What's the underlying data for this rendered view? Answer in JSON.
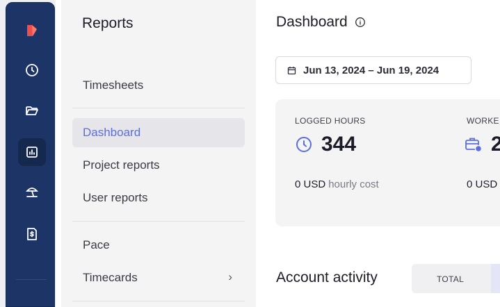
{
  "rail": {
    "items": [
      {
        "icon": "app-logo-icon"
      },
      {
        "icon": "clock-icon"
      },
      {
        "icon": "folder-icon"
      },
      {
        "icon": "reports-chart-icon",
        "active": true
      },
      {
        "icon": "beach-umbrella-icon"
      },
      {
        "icon": "invoice-dollar-icon"
      }
    ],
    "colors": {
      "bg": "#1d3466",
      "logo": "#f04e4e"
    }
  },
  "sidebar": {
    "title": "Reports",
    "items": [
      {
        "label": "Timesheets"
      },
      {
        "label": "Dashboard",
        "active": true
      },
      {
        "label": "Project reports"
      },
      {
        "label": "User reports"
      },
      {
        "label": "Pace"
      },
      {
        "label": "Timecards",
        "chevron": "›"
      }
    ]
  },
  "main": {
    "title": "Dashboard",
    "date_range": "Jun 13, 2024 – Jun 19, 2024",
    "stats": [
      {
        "label": "LOGGED HOURS",
        "value": "344",
        "cost": "0 USD",
        "cost_note": "hourly cost",
        "icon": "clock-icon"
      },
      {
        "label": "WORKE",
        "value": "2",
        "cost": "0 USD",
        "cost_note": "",
        "icon": "briefcase-clock-icon"
      }
    ],
    "activity_title": "Account activity",
    "activity_tabs": [
      {
        "label": "TOTAL"
      }
    ]
  },
  "colors": {
    "accent": "#5b6ee1"
  }
}
